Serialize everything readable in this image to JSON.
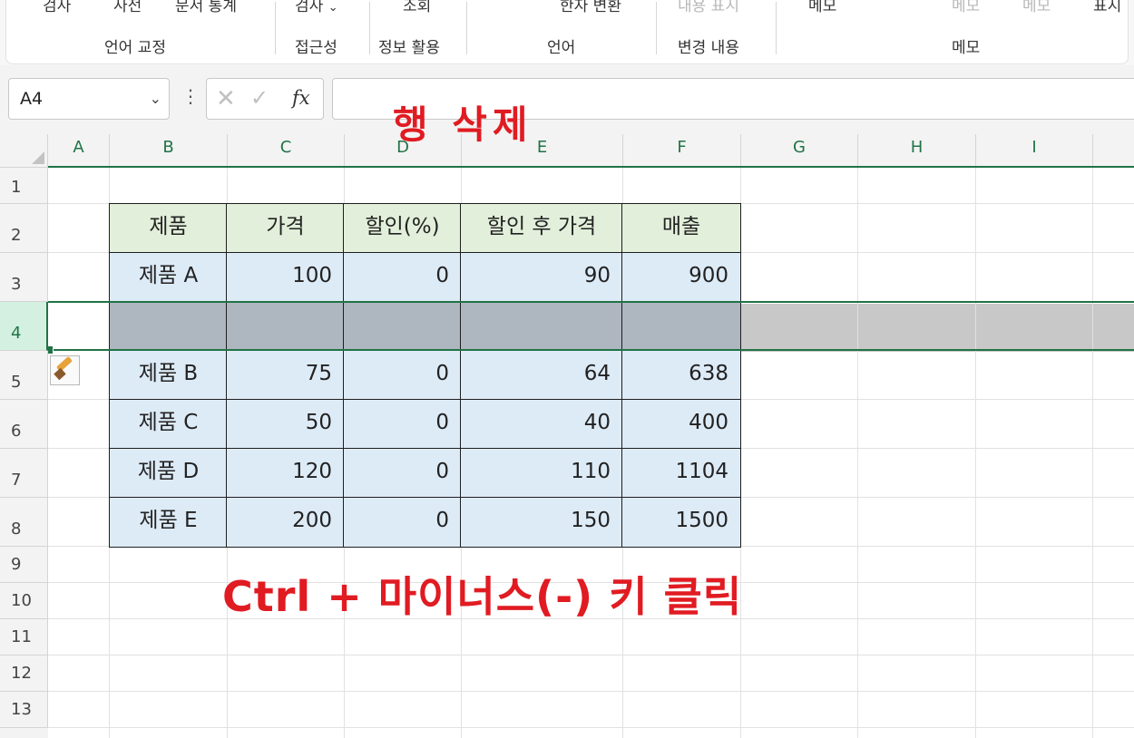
{
  "ribbon": {
    "top_items": [
      "검사",
      "사전",
      "문서 통계",
      "검사",
      "조회",
      "한자 변환",
      "내용 표시",
      "메모",
      "메모",
      "메모",
      "표시"
    ],
    "dropdown_chevron": "chevron-down-icon",
    "groups": [
      "언어 교정",
      "접근성",
      "정보 활용",
      "언어",
      "변경 내용",
      "메모"
    ]
  },
  "formula_bar": {
    "name_box": "A4",
    "formula": ""
  },
  "columns": [
    "A",
    "B",
    "C",
    "D",
    "E",
    "F",
    "G",
    "H",
    "I"
  ],
  "rows": [
    "1",
    "2",
    "3",
    "4",
    "5",
    "6",
    "7",
    "8",
    "9",
    "10",
    "11",
    "12",
    "13"
  ],
  "selected_row": "4",
  "table": {
    "headers": [
      "제품",
      "가격",
      "할인(%)",
      "할인 후 가격",
      "매출"
    ],
    "rows": [
      [
        "제품 A",
        "100",
        "0",
        "90",
        "900"
      ],
      [
        "",
        "",
        "",
        "",
        ""
      ],
      [
        "제품 B",
        "75",
        "0",
        "64",
        "638"
      ],
      [
        "제품 C",
        "50",
        "0",
        "40",
        "400"
      ],
      [
        "제품 D",
        "120",
        "0",
        "110",
        "1104"
      ],
      [
        "제품 E",
        "200",
        "0",
        "150",
        "1500"
      ]
    ]
  },
  "annotations": {
    "title": "행 삭제",
    "instruction": "Ctrl + 마이너스(-) 키 클릭"
  },
  "colors": {
    "selection_accent": "#217346",
    "annotation_red": "#e11b22",
    "header_fill": "#e2efda",
    "body_fill": "#ddebf7",
    "deleted_row_fill": "#aeb6bf"
  }
}
